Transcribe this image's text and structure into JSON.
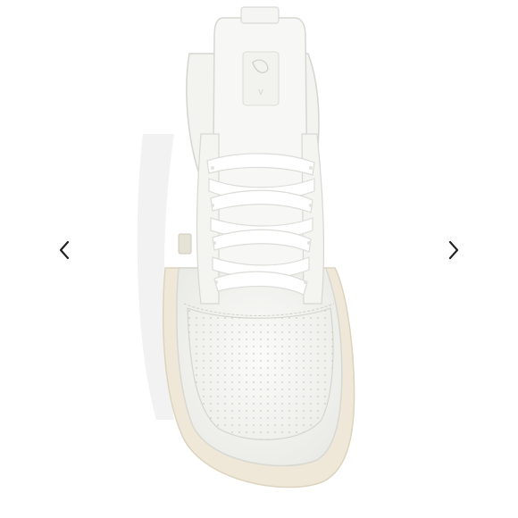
{
  "gallery": {
    "prev_label": "",
    "next_label": "",
    "icons": {
      "prev": "chevron-left-icon",
      "next": "chevron-right-icon"
    },
    "colors": {
      "background": "#ffffff",
      "arrow": "#222222",
      "shoe": "#f4f4f1",
      "sole": "#efe8d8",
      "laces": "#ffffff"
    }
  }
}
